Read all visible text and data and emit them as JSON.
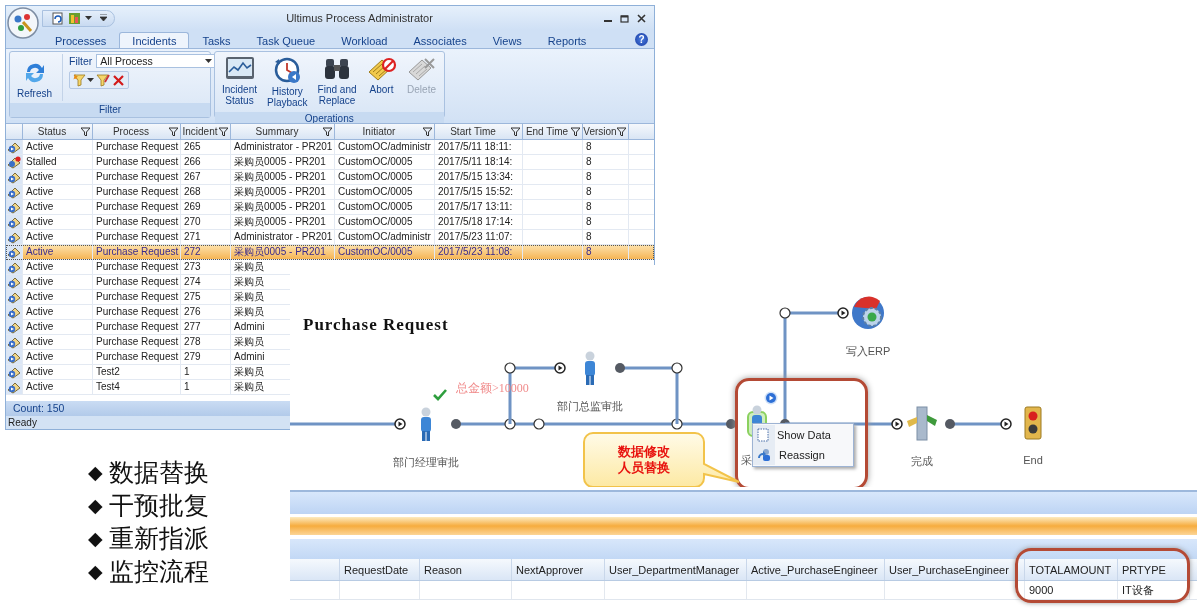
{
  "admin_window": {
    "title": "Ultimus Process Administrator",
    "help": "?",
    "tabs": [
      {
        "label": "Processes",
        "selected": false
      },
      {
        "label": "Incidents",
        "selected": true
      },
      {
        "label": "Tasks",
        "selected": false
      },
      {
        "label": "Task Queue",
        "selected": false
      },
      {
        "label": "Workload",
        "selected": false
      },
      {
        "label": "Associates",
        "selected": false
      },
      {
        "label": "Views",
        "selected": false
      },
      {
        "label": "Reports",
        "selected": false
      }
    ],
    "ribbon": {
      "refresh": "Refresh",
      "filter_label": "Filter",
      "filter_value": "All Process",
      "filter_group": "Filter",
      "operations": [
        {
          "label": "Incident\nStatus",
          "kind": "status",
          "disabled": false
        },
        {
          "label": "History\nPlayback",
          "kind": "history",
          "disabled": false
        },
        {
          "label": "Find and\nReplace",
          "kind": "find",
          "disabled": false
        },
        {
          "label": "Abort",
          "kind": "abort",
          "disabled": false
        },
        {
          "label": "Delete",
          "kind": "delete",
          "disabled": true
        }
      ],
      "operations_group": "Operations"
    },
    "grid": {
      "columns": [
        "Status",
        "Process",
        "Incident",
        "Summary",
        "Initiator",
        "Start Time",
        "End Time",
        "Version"
      ],
      "rows": [
        {
          "kind": "active",
          "status": "Active",
          "process": "Purchase Request",
          "incident": "265",
          "summary": "Administrator - PR201",
          "initiator": "CustomOC/administr",
          "start_time": "2017/5/11 18:11:",
          "version": "8",
          "selected": false
        },
        {
          "kind": "stalled",
          "status": "Stalled",
          "process": "Purchase Request",
          "incident": "266",
          "summary": "采购员0005 - PR201",
          "initiator": "CustomOC/0005",
          "start_time": "2017/5/11 18:14:",
          "version": "8",
          "selected": false
        },
        {
          "kind": "active",
          "status": "Active",
          "process": "Purchase Request",
          "incident": "267",
          "summary": "采购员0005 - PR201",
          "initiator": "CustomOC/0005",
          "start_time": "2017/5/15 13:34:",
          "version": "8",
          "selected": false
        },
        {
          "kind": "active",
          "status": "Active",
          "process": "Purchase Request",
          "incident": "268",
          "summary": "采购员0005 - PR201",
          "initiator": "CustomOC/0005",
          "start_time": "2017/5/15 15:52:",
          "version": "8",
          "selected": false
        },
        {
          "kind": "active",
          "status": "Active",
          "process": "Purchase Request",
          "incident": "269",
          "summary": "采购员0005 - PR201",
          "initiator": "CustomOC/0005",
          "start_time": "2017/5/17 13:11:",
          "version": "8",
          "selected": false
        },
        {
          "kind": "active",
          "status": "Active",
          "process": "Purchase Request",
          "incident": "270",
          "summary": "采购员0005 - PR201",
          "initiator": "CustomOC/0005",
          "start_time": "2017/5/18 17:14:",
          "version": "8",
          "selected": false
        },
        {
          "kind": "active",
          "status": "Active",
          "process": "Purchase Request",
          "incident": "271",
          "summary": "Administrator - PR201",
          "initiator": "CustomOC/administr",
          "start_time": "2017/5/23 11:07:",
          "version": "8",
          "selected": false
        },
        {
          "kind": "active",
          "status": "Active",
          "process": "Purchase Request",
          "incident": "272",
          "summary": "采购员0005 - PR201",
          "initiator": "CustomOC/0005",
          "start_time": "2017/5/23 11:08:",
          "version": "8",
          "selected": true
        },
        {
          "kind": "active",
          "status": "Active",
          "process": "Purchase Request",
          "incident": "273",
          "summary": "采购员",
          "selected": false
        },
        {
          "kind": "active",
          "status": "Active",
          "process": "Purchase Request",
          "incident": "274",
          "summary": "采购员",
          "selected": false
        },
        {
          "kind": "active",
          "status": "Active",
          "process": "Purchase Request",
          "incident": "275",
          "summary": "采购员",
          "selected": false
        },
        {
          "kind": "active",
          "status": "Active",
          "process": "Purchase Request",
          "incident": "276",
          "summary": "采购员",
          "selected": false
        },
        {
          "kind": "active",
          "status": "Active",
          "process": "Purchase Request",
          "incident": "277",
          "summary": "Admini",
          "selected": false
        },
        {
          "kind": "active",
          "status": "Active",
          "process": "Purchase Request",
          "incident": "278",
          "summary": "采购员",
          "selected": false
        },
        {
          "kind": "active",
          "status": "Active",
          "process": "Purchase Request",
          "incident": "279",
          "summary": "Admini",
          "selected": false
        },
        {
          "kind": "active",
          "status": "Active",
          "process": "Test2",
          "incident": "1",
          "summary": "采购员",
          "selected": false
        },
        {
          "kind": "active",
          "status": "Active",
          "process": "Test4",
          "incident": "1",
          "summary": "采购员",
          "selected": false
        }
      ]
    },
    "count": "Count: 150",
    "status_bar": "Ready"
  },
  "process_window": {
    "title": "Purchase Request",
    "condition": {
      "text": "总金额>10000",
      "satisfied": true
    },
    "nodes": [
      {
        "label": "部门经理审批",
        "kind": "person",
        "active": false
      },
      {
        "label": "部门总监审批",
        "kind": "person",
        "active": false
      },
      {
        "label": "采",
        "kind": "person",
        "active": true
      },
      {
        "label": "写入ERP",
        "kind": "integration",
        "active": false
      },
      {
        "label": "完成",
        "kind": "junction",
        "active": false
      },
      {
        "label": "End",
        "kind": "end",
        "active": false
      }
    ],
    "context_menu": [
      {
        "label": "Show Data",
        "kind": "data"
      },
      {
        "label": "Reassign",
        "kind": "reassign"
      }
    ],
    "callout": [
      "数据修改",
      "人员替换"
    ],
    "table": {
      "columns": [
        "",
        "RequestDate",
        "Reason",
        "NextApprover",
        "User_DepartmentManager",
        "Active_PurchaseEngineer",
        "User_PurchaseEngineer",
        "TOTALAMOUNT",
        "PRTYPE"
      ],
      "rows": [
        [
          "",
          "",
          "",
          "",
          "",
          "",
          "",
          "9000",
          "IT设备"
        ]
      ]
    }
  },
  "bullets": [
    {
      "marker": "◆",
      "text": "数据替换"
    },
    {
      "marker": "◆",
      "text": "干预批复"
    },
    {
      "marker": "◆",
      "text": "重新指派"
    },
    {
      "marker": "◆",
      "text": "监控流程"
    }
  ]
}
